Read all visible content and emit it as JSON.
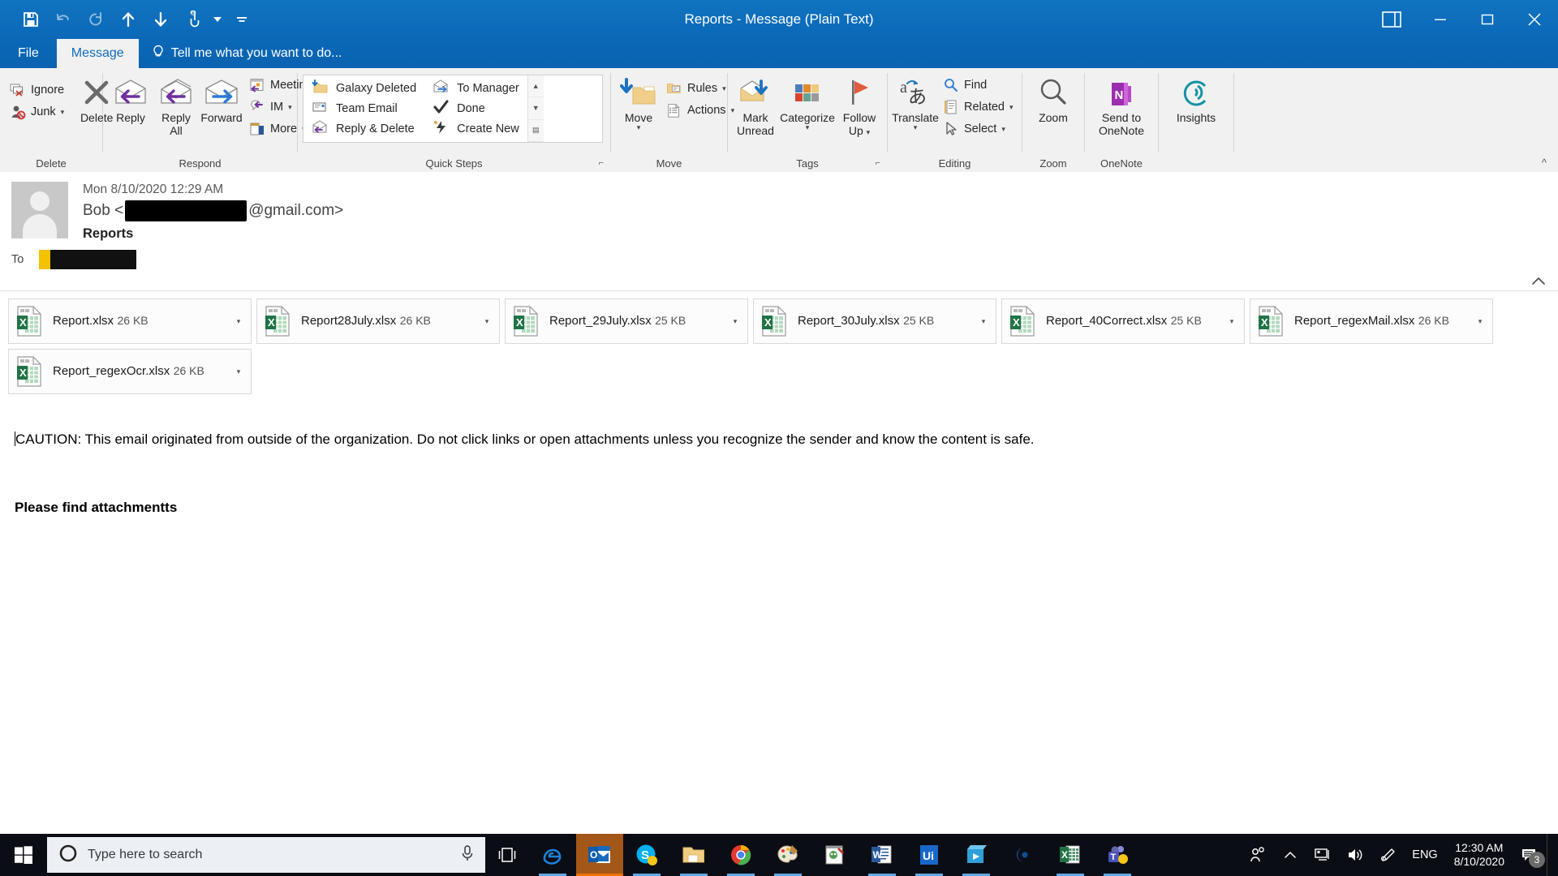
{
  "window": {
    "title": "Reports - Message (Plain Text)",
    "quick_access": [
      {
        "name": "save-icon",
        "glyph": "save"
      },
      {
        "name": "undo-icon",
        "glyph": "undo"
      },
      {
        "name": "redo-icon",
        "glyph": "redo"
      },
      {
        "name": "previous-item-icon",
        "glyph": "up"
      },
      {
        "name": "next-item-icon",
        "glyph": "down"
      },
      {
        "name": "touch-mode-icon",
        "glyph": "touch"
      },
      {
        "name": "customize-qat-icon",
        "glyph": "bars"
      }
    ],
    "controls": {
      "ribbon_display": "ribbon-display-options",
      "minimize": "minimize",
      "maximize": "maximize",
      "close": "close"
    }
  },
  "tabs": {
    "file": "File",
    "message": "Message",
    "tellme": "Tell me what you want to do..."
  },
  "ribbon": {
    "groups": [
      {
        "label": "Delete",
        "small": [
          {
            "label": "Ignore",
            "icon": "ignore-icon"
          },
          {
            "label": "Junk",
            "icon": "junk-icon",
            "caret": true
          }
        ],
        "big": [
          {
            "label": "Delete",
            "label2": "",
            "icon": "delete-icon"
          }
        ]
      },
      {
        "label": "Respond",
        "big": [
          {
            "label": "Reply",
            "label2": "",
            "icon": "reply-icon"
          },
          {
            "label": "Reply",
            "label2": "All",
            "icon": "reply-all-icon"
          },
          {
            "label": "Forward",
            "label2": "",
            "icon": "forward-icon"
          }
        ],
        "small": [
          {
            "label": "Meeting",
            "icon": "meeting-icon"
          },
          {
            "label": "IM",
            "icon": "im-icon",
            "caret": true
          },
          {
            "label": "More",
            "icon": "more-icon",
            "caret": true
          }
        ]
      },
      {
        "label": "Quick Steps",
        "has_launcher": true,
        "quick_steps": [
          {
            "label": "Galaxy Deleted",
            "icon": "folder-move-icon"
          },
          {
            "label": "Team Email",
            "icon": "team-email-icon"
          },
          {
            "label": "Reply & Delete",
            "icon": "reply-delete-icon"
          },
          {
            "label": "To Manager",
            "icon": "to-manager-icon"
          },
          {
            "label": "Done",
            "icon": "done-check-icon"
          },
          {
            "label": "Create New",
            "icon": "create-new-icon"
          }
        ]
      },
      {
        "label": "Move",
        "big": [
          {
            "label": "Move",
            "label2": "",
            "icon": "move-folder-icon",
            "caret": true
          }
        ],
        "small": [
          {
            "label": "Rules",
            "icon": "rules-icon",
            "caret": true
          },
          {
            "label": "Actions",
            "icon": "actions-icon",
            "caret": true
          }
        ]
      },
      {
        "label": "Tags",
        "has_launcher": true,
        "big": [
          {
            "label": "Mark",
            "label2": "Unread",
            "icon": "mark-unread-icon"
          },
          {
            "label": "Categorize",
            "label2": "",
            "icon": "categorize-icon",
            "caret": true
          },
          {
            "label": "Follow",
            "label2": "Up",
            "icon": "follow-up-flag-icon",
            "caret": true
          }
        ]
      },
      {
        "label": "Editing",
        "big": [
          {
            "label": "Translate",
            "label2": "",
            "icon": "translate-icon",
            "caret": true
          }
        ],
        "small": [
          {
            "label": "Find",
            "icon": "find-icon"
          },
          {
            "label": "Related",
            "icon": "related-icon",
            "caret": true
          },
          {
            "label": "Select",
            "icon": "select-icon",
            "caret": true
          }
        ]
      },
      {
        "label": "Zoom",
        "big": [
          {
            "label": "Zoom",
            "label2": "",
            "icon": "zoom-magnifier-icon"
          }
        ]
      },
      {
        "label": "OneNote",
        "big": [
          {
            "label": "Send to",
            "label2": "OneNote",
            "icon": "onenote-icon"
          }
        ]
      },
      {
        "label": "",
        "big": [
          {
            "label": "Insights",
            "label2": "",
            "icon": "insights-icon"
          }
        ]
      }
    ],
    "collapse_arrow": "^"
  },
  "message": {
    "date": "Mon 8/10/2020 12:29 AM",
    "from_prefix": "Bob  <",
    "from_domain": "@gmail.com>",
    "subject": "Reports",
    "to_label": "To",
    "expand_icon": "chevron-up-icon"
  },
  "attachments": [
    {
      "name": "Report.xlsx",
      "size": "26 KB"
    },
    {
      "name": "Report28July.xlsx",
      "size": "26 KB"
    },
    {
      "name": "Report_29July.xlsx",
      "size": "25 KB"
    },
    {
      "name": "Report_30July.xlsx",
      "size": "25 KB"
    },
    {
      "name": "Report_40Correct.xlsx",
      "size": "25 KB"
    },
    {
      "name": "Report_regexMail.xlsx",
      "size": "26 KB"
    },
    {
      "name": "Report_regexOcr.xlsx",
      "size": "26 KB"
    }
  ],
  "body": {
    "caution": "CAUTION: This email originated from outside of the organization. Do not click links or open attachments unless you recognize the sender and know the content is safe.",
    "text": "Please find attachmentts"
  },
  "taskbar": {
    "start_icon": "windows-start-icon",
    "search_placeholder": "Type here to search",
    "cortana_icon": "cortana-circle-icon",
    "mic_icon": "microphone-icon",
    "taskview_icon": "task-view-icon",
    "apps": [
      {
        "name": "edge-icon",
        "active": false,
        "open": true
      },
      {
        "name": "outlook-icon",
        "active": true,
        "open": true
      },
      {
        "name": "skype-icon",
        "active": false,
        "open": true
      },
      {
        "name": "file-explorer-icon",
        "active": false,
        "open": true
      },
      {
        "name": "chrome-icon",
        "active": false,
        "open": true
      },
      {
        "name": "paint-icon",
        "active": false,
        "open": true
      },
      {
        "name": "notepad-icon",
        "active": false,
        "open": false
      },
      {
        "name": "word-icon",
        "active": false,
        "open": true
      },
      {
        "name": "uipath-icon",
        "active": false,
        "open": true
      },
      {
        "name": "movies-tv-icon",
        "active": false,
        "open": true
      },
      {
        "name": "photos-icon",
        "active": false,
        "open": false
      },
      {
        "name": "excel-icon",
        "active": false,
        "open": true
      },
      {
        "name": "teams-icon",
        "active": false,
        "open": true
      }
    ],
    "tray": {
      "people_icon": "people-icon",
      "chevron_icon": "show-hidden-icons-icon",
      "network_icon": "network-icon",
      "volume_icon": "volume-icon",
      "pen_icon": "pen-icon",
      "language": "ENG",
      "time": "12:30 AM",
      "date": "8/10/2020",
      "notification_icon": "action-center-icon",
      "notification_count": "3"
    }
  },
  "colors": {
    "titlebar": "#0f6cbd",
    "ribbon_bg": "#f1f1f1",
    "excel_green": "#217346",
    "taskbar": "#0b0d15",
    "accent": "#0078d7"
  }
}
